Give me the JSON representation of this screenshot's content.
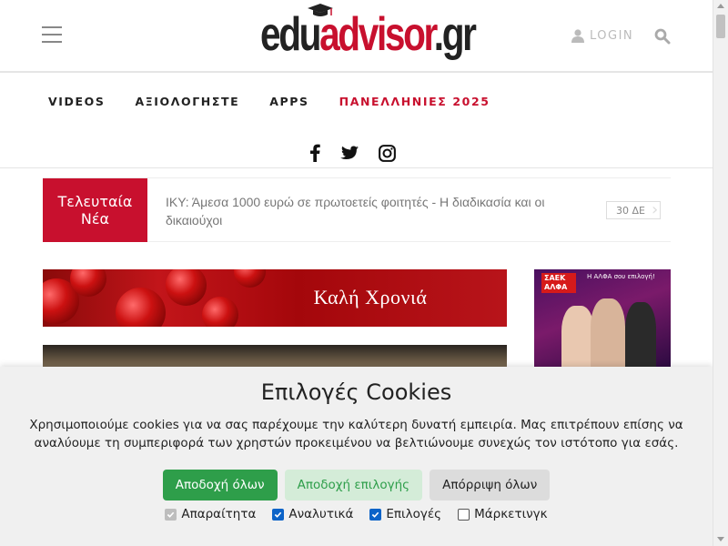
{
  "header": {
    "logo": {
      "part1": "edu",
      "part2": "advisor",
      "part3": ".gr"
    },
    "login_label": "LOGIN"
  },
  "nav": {
    "items": [
      {
        "label": "VIDEOS"
      },
      {
        "label": "ΑΞΙΟΛΟΓΗΣΤΕ"
      },
      {
        "label": "APPS"
      },
      {
        "label": "ΠΑΝΕΛΛΗΝΙΕΣ 2025"
      }
    ],
    "social": [
      "facebook-icon",
      "twitter-icon",
      "instagram-icon"
    ]
  },
  "ticker": {
    "label": "Τελευταία Νέα",
    "headline": "ΙΚΥ: Άμεσα 1000 ευρώ σε πρωτοετείς φοιτητές - Η διαδικασία και οι δικαιούχοι",
    "time": "30 ΔΕ"
  },
  "banner": {
    "text": "Καλή Χρονιά"
  },
  "side_ad": {
    "logo_text": "ΣΑΕΚ ΑΛΦΑ",
    "tagline": "Η ΑΛΦΑ σου επιλογή!"
  },
  "cookie": {
    "title": "Επιλογές Cookies",
    "description": "Χρησιμοποιούμε cookies για να σας παρέχουμε την καλύτερη δυνατή εμπειρία. Μας επιτρέπουν επίσης να αναλύουμε τη συμπεριφορά των χρηστών προκειμένου να βελτιώνουμε συνεχώς τον ιστότοπο για εσάς.",
    "buttons": {
      "accept_all": "Αποδοχή όλων",
      "accept_selection": "Αποδοχή επιλογής",
      "reject_all": "Απόρριψη όλων"
    },
    "checkboxes": [
      {
        "label": "Απαραίτητα",
        "checked": true,
        "disabled": true
      },
      {
        "label": "Αναλυτικά",
        "checked": true,
        "disabled": false
      },
      {
        "label": "Επιλογές",
        "checked": true,
        "disabled": false
      },
      {
        "label": "Μάρκετινγκ",
        "checked": false,
        "disabled": false
      }
    ]
  },
  "colors": {
    "brand_red": "#c8102e",
    "accept_green": "#2e9e4a",
    "checkbox_blue": "#0b63c8"
  }
}
